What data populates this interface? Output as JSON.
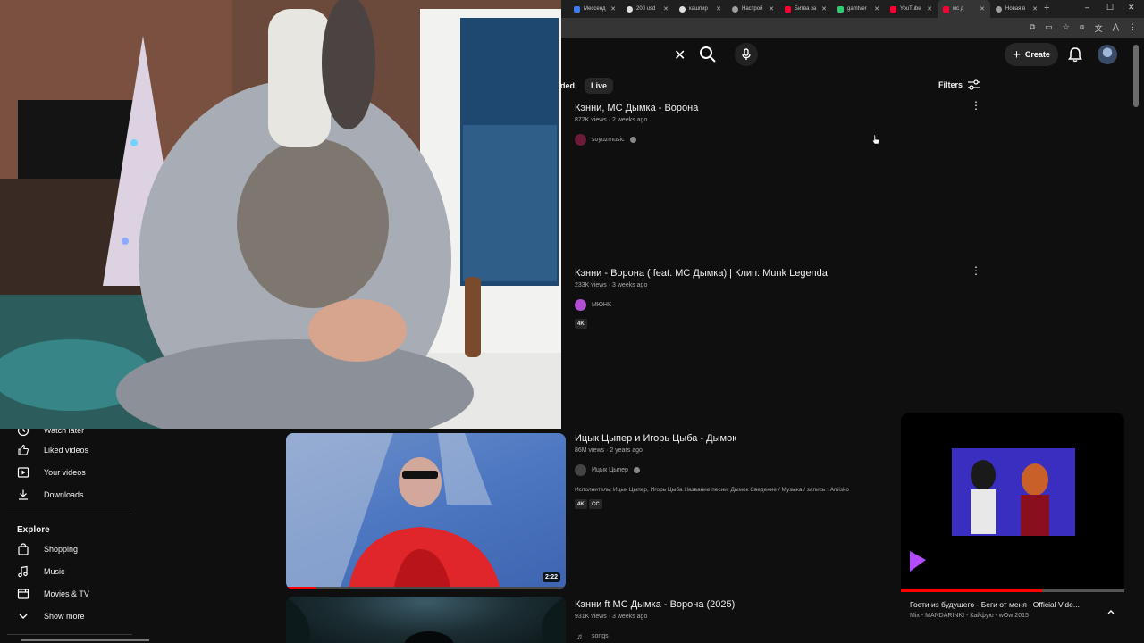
{
  "browser": {
    "tabs": [
      {
        "label": "Мессенд",
        "color": "#3b7bf6",
        "active": false
      },
      {
        "label": "200 usd",
        "color": "#e0e0e0",
        "active": false
      },
      {
        "label": "кашпир",
        "color": "#e0e0e0",
        "active": false
      },
      {
        "label": "Настрой",
        "color": "#9e9e9e",
        "active": false
      },
      {
        "label": "Битва за",
        "color": "#ff0033",
        "active": false
      },
      {
        "label": "gamtver",
        "color": "#2ecc71",
        "active": false
      },
      {
        "label": "YouTube",
        "color": "#ff0033",
        "active": false
      },
      {
        "label": "мс д",
        "color": "#ff0033",
        "active": true
      },
      {
        "label": "Новая в",
        "color": "#9e9e9e",
        "active": false
      }
    ],
    "new_tab": "+",
    "window_controls": {
      "minimize": "–",
      "maximize": "☐",
      "close": "✕"
    }
  },
  "header": {
    "create_label": "Create",
    "clear_icon": "close-icon",
    "search_icon": "search-icon",
    "mic_icon": "mic-icon",
    "bell_icon": "bell-icon"
  },
  "chips": [
    {
      "label": "ded"
    },
    {
      "label": "Live"
    }
  ],
  "filters_label": "Filters",
  "results": [
    {
      "title": "Кэнни, МС Дымка - Ворона",
      "views": "872K views",
      "age": "2 weeks ago",
      "channel": "soyuzmusic",
      "verified": true,
      "badges": []
    },
    {
      "title": "Кэнни - Ворона ( feat. МС Дымка) | Клип: Munk Legenda",
      "views": "233K views",
      "age": "3 weeks ago",
      "channel": "МЮНК",
      "verified": false,
      "badges": [
        "4K"
      ]
    },
    {
      "title": "Ицык Цыпер и Игорь Цыба - Дымок",
      "views": "86M views",
      "age": "2 years ago",
      "channel": "Ицык Цыпер",
      "verified": true,
      "description": "Исполнитель: Ицык Цыпер, Игорь Цыба Название песни: Дымок Сведение / Музыка / запись : Amisko",
      "badges": [
        "4K",
        "CC"
      ],
      "duration": "2:22"
    },
    {
      "title": "Кэнни ft МС Дымка - Ворона (2025)",
      "views": "931K views",
      "age": "3 weeks ago",
      "channel": "songs",
      "verified": false,
      "badges": []
    }
  ],
  "sidebar": {
    "items": [
      {
        "label": "Watch later",
        "icon": "clock-icon"
      },
      {
        "label": "Liked videos",
        "icon": "thumbs-up-icon"
      },
      {
        "label": "Your videos",
        "icon": "play-square-icon"
      },
      {
        "label": "Downloads",
        "icon": "download-icon"
      }
    ],
    "explore_heading": "Explore",
    "explore_items": [
      {
        "label": "Shopping",
        "icon": "shopping-bag-icon"
      },
      {
        "label": "Music",
        "icon": "music-note-icon"
      },
      {
        "label": "Movies & TV",
        "icon": "film-icon"
      },
      {
        "label": "Show more",
        "icon": "chevron-down-icon"
      }
    ]
  },
  "miniplayer": {
    "title": "Гости из будущего - Беги от меня | Official Vide...",
    "subtitle": "Mix - MANDARINKI - Кайфую - wOw 2015",
    "progress": 0.63
  },
  "colors": {
    "background": "#0f0f0f",
    "accent_red": "#ff0000",
    "chip_bg": "#272727",
    "text_secondary": "#aaaaaa"
  }
}
